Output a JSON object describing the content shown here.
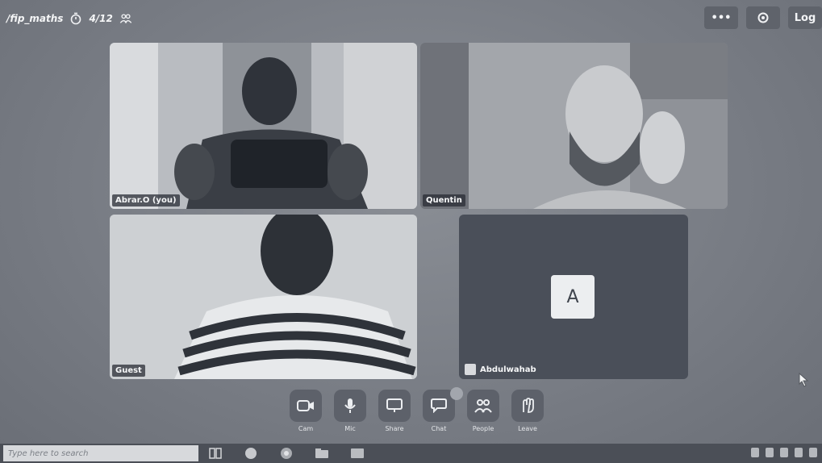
{
  "topbar": {
    "room_name": "/fip_maths",
    "participant_count": "4/12",
    "more_label": "•••",
    "logout_label": "Log"
  },
  "tiles": [
    {
      "name": "Abrar.O (you)"
    },
    {
      "name": "Quentin"
    },
    {
      "name": "Guest"
    },
    {
      "name": "Abdulwahab",
      "avatar_letter": "A"
    }
  ],
  "controls": [
    {
      "label": "Cam",
      "icon": "camera-icon"
    },
    {
      "label": "Mic",
      "icon": "microphone-icon"
    },
    {
      "label": "Share",
      "icon": "screen-share-icon"
    },
    {
      "label": "Chat",
      "icon": "chat-icon"
    },
    {
      "label": "People",
      "icon": "people-icon"
    },
    {
      "label": "Leave",
      "icon": "leave-icon"
    }
  ],
  "taskbar": {
    "search_placeholder": "Type here to search"
  }
}
